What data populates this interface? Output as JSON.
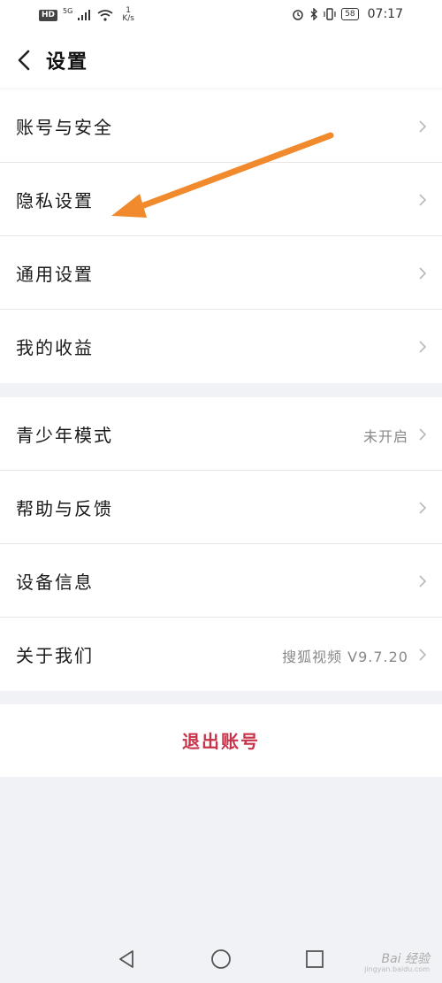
{
  "status_bar": {
    "hd": "HD",
    "net": "5G",
    "speed_value": "1",
    "speed_unit": "K/s",
    "battery": "58",
    "time": "07:17"
  },
  "header": {
    "title": "设置",
    "back_icon": "chevron-left-icon"
  },
  "group1": [
    {
      "label": "账号与安全",
      "value": ""
    },
    {
      "label": "隐私设置",
      "value": ""
    },
    {
      "label": "通用设置",
      "value": ""
    },
    {
      "label": "我的收益",
      "value": ""
    }
  ],
  "group2": [
    {
      "label": "青少年模式",
      "value": "未开启"
    },
    {
      "label": "帮助与反馈",
      "value": ""
    },
    {
      "label": "设备信息",
      "value": ""
    },
    {
      "label": "关于我们",
      "value": "搜狐视频 V9.7.20"
    }
  ],
  "logout": {
    "label": "退出账号",
    "color": "#c8334a"
  },
  "annotation": {
    "arrow_color": "#f08a2c"
  },
  "nav_bar": {
    "back": "triangle-back-icon",
    "home": "circle-home-icon",
    "recent": "square-recent-icon"
  },
  "watermark": {
    "text": "Bai 经验",
    "sub": "jingyan.baidu.com"
  }
}
